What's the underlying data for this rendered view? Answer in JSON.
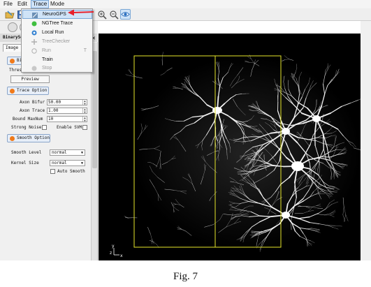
{
  "menubar": {
    "items": [
      "File",
      "Edit",
      "Trace",
      "Mode"
    ]
  },
  "trace_menu": {
    "items": [
      {
        "label": "NeuroGPS",
        "shortcut": "",
        "enabled": true,
        "highlighted": true,
        "icon": "neurogps-icon"
      },
      {
        "label": "NGTree Trace",
        "shortcut": "",
        "enabled": true,
        "highlighted": false,
        "icon": "tree-trace-icon"
      },
      {
        "label": "Local Run",
        "shortcut": "",
        "enabled": true,
        "highlighted": false,
        "icon": "local-run-icon"
      },
      {
        "label": "TreeChecker",
        "shortcut": "",
        "enabled": false,
        "highlighted": false,
        "icon": "tree-checker-icon"
      },
      {
        "label": "Run",
        "shortcut": "T",
        "enabled": false,
        "highlighted": false,
        "icon": "run-icon"
      },
      {
        "label": "Train",
        "shortcut": "",
        "enabled": true,
        "highlighted": false,
        "icon": ""
      },
      {
        "label": "Stop",
        "shortcut": "",
        "enabled": false,
        "highlighted": false,
        "icon": "stop-icon"
      }
    ],
    "pointer_color": "#e8202a"
  },
  "left_panel": {
    "dock_title": "BinarySetti",
    "tabs": [
      "Image",
      "V"
    ],
    "binary_section": "Binar",
    "threshold_label": "Threshol",
    "preview_button": "Preview",
    "trace_option_section": "Trace Option",
    "axon_bifur_label": "Axon Bifur",
    "axon_bifur_value": "50.00",
    "axon_trace_label": "Axon Trace",
    "axon_trace_value": "1.00",
    "bound_maxnum_label": "Bound MaxNum",
    "bound_maxnum_value": "10",
    "strong_noise_label": "Strong Noise",
    "enable_svm_label": "Enable SVM",
    "smooth_option_section": "Smooth Option",
    "smooth_level_label": "Smooth Level",
    "smooth_level_value": "normal",
    "kernel_size_label": "Kernel Size",
    "kernel_size_value": "normal",
    "auto_smooth_label": "Auto Smooth"
  },
  "viewer": {
    "axis_labels": [
      "y",
      "z",
      "x"
    ],
    "bbox_color": "#e6e62a",
    "background": "#000000"
  },
  "caption": "Fig. 7"
}
